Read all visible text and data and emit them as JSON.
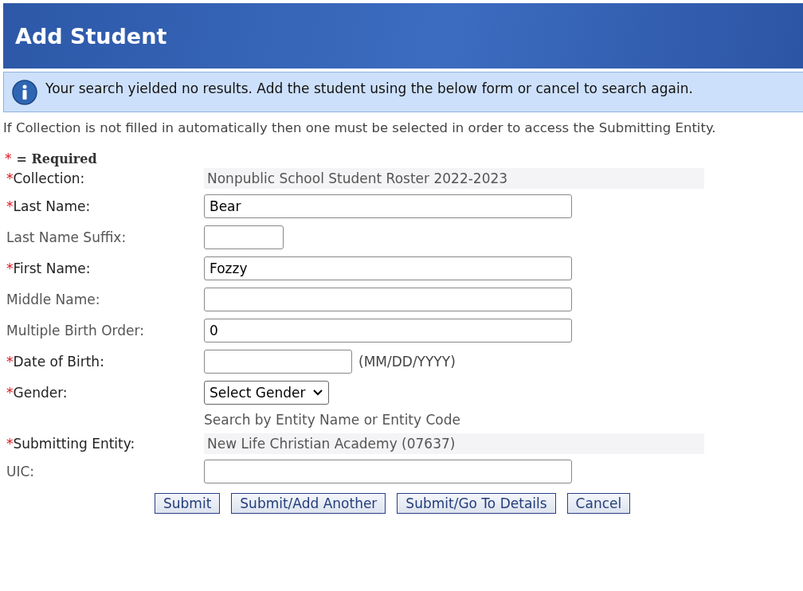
{
  "header": {
    "title": "Add Student"
  },
  "alert": {
    "message": "Your search yielded no results. Add the student using the below form or cancel to search again."
  },
  "note": "If Collection is not filled in automatically then one must be selected in order to access the Submitting Entity.",
  "legend": {
    "mark": "*",
    "text": "= Required"
  },
  "fields": [
    {
      "kind": "readonly",
      "label": "Collection:",
      "required": true,
      "value": "Nonpublic School Student Roster 2022-2023"
    },
    {
      "kind": "text",
      "label": "Last Name:",
      "required": true,
      "value": "Bear"
    },
    {
      "kind": "short",
      "label": "Last Name Suffix:",
      "required": false
    },
    {
      "kind": "text",
      "label": "First Name:",
      "required": true,
      "value": "Fozzy"
    },
    {
      "kind": "text",
      "label": "Middle Name:",
      "required": false
    },
    {
      "kind": "text",
      "label": "Multiple Birth Order:",
      "required": false,
      "value": "0"
    },
    {
      "kind": "date",
      "label": "Date of Birth:",
      "required": true,
      "hint": "(MM/DD/YYYY)"
    },
    {
      "kind": "select",
      "label": "Gender:",
      "required": true,
      "value": "Select Gender"
    },
    {
      "kind": "note",
      "text": "Search by Entity Name or Entity Code"
    },
    {
      "kind": "readonly",
      "label": "Submitting Entity:",
      "required": true,
      "value": "New Life Christian Academy (07637)"
    },
    {
      "kind": "text",
      "label": "UIC:",
      "required": false
    }
  ],
  "buttons": [
    "Submit",
    "Submit/Add Another",
    "Submit/Go To Details",
    "Cancel"
  ]
}
